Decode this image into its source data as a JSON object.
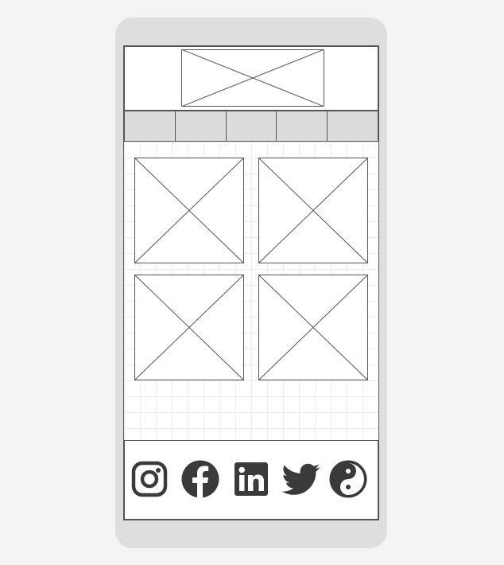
{
  "colors": {
    "frame": "#dedede",
    "stroke": "#555555",
    "tab_fill": "#dcdcdc",
    "icon": "#3a3a3a"
  },
  "header": {
    "banner_icon": "image-placeholder-icon"
  },
  "nav": {
    "tabs": [
      "",
      "",
      "",
      "",
      ""
    ]
  },
  "gallery": {
    "items": [
      "image-placeholder-icon",
      "image-placeholder-icon",
      "image-placeholder-icon",
      "image-placeholder-icon"
    ]
  },
  "footer": {
    "social_icons": [
      "instagram-icon",
      "facebook-icon",
      "linkedin-icon",
      "twitter-icon",
      "yin-yang-icon"
    ]
  }
}
